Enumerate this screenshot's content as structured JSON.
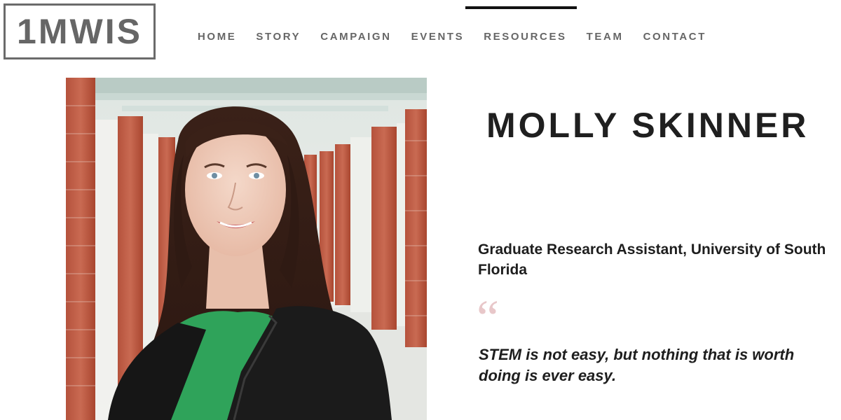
{
  "header": {
    "logo_text": "1MWIS",
    "nav": [
      {
        "label": "HOME",
        "active": false
      },
      {
        "label": "STORY",
        "active": false
      },
      {
        "label": "CAMPAIGN",
        "active": false
      },
      {
        "label": "EVENTS",
        "active": false
      },
      {
        "label": "RESOURCES",
        "active": true
      },
      {
        "label": "TEAM",
        "active": false
      },
      {
        "label": "CONTACT",
        "active": false
      }
    ]
  },
  "profile": {
    "name": "MOLLY SKINNER",
    "role": "Graduate Research Assistant, University of South Florida",
    "quote_mark": "“",
    "quote": "STEM is not easy, but nothing that is worth doing is ever easy."
  },
  "colors": {
    "nav_text": "#666666",
    "active_indicator": "#111111",
    "quote_mark": "#e8c7c9",
    "heading": "#1f1f1f"
  }
}
